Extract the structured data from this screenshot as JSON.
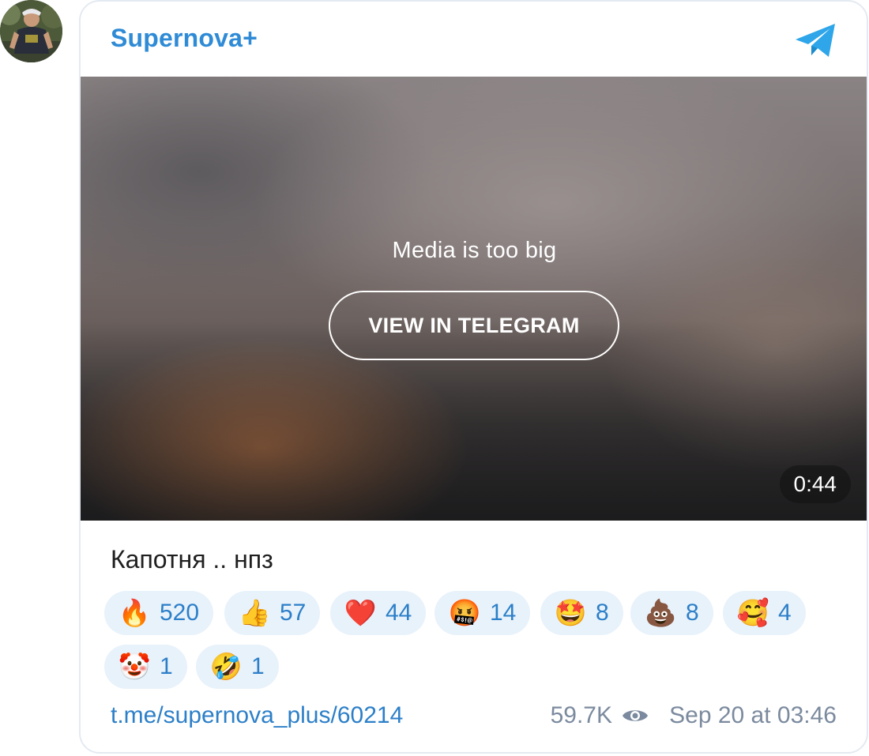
{
  "post": {
    "channel_name": "Supernova+",
    "media": {
      "message": "Media is too big",
      "button_label": "VIEW IN TELEGRAM",
      "duration": "0:44"
    },
    "caption": "Капотня .. нпз",
    "reactions": [
      {
        "emoji": "🔥",
        "icon": "fire-icon",
        "count": "520"
      },
      {
        "emoji": "👍",
        "icon": "thumbs-up-icon",
        "count": "57"
      },
      {
        "emoji": "❤️",
        "icon": "heart-icon",
        "count": "44"
      },
      {
        "emoji": "🤬",
        "icon": "cursing-face-icon",
        "count": "14"
      },
      {
        "emoji": "🤩",
        "icon": "star-struck-icon",
        "count": "8"
      },
      {
        "emoji": "💩",
        "icon": "poop-icon",
        "count": "8"
      },
      {
        "emoji": "🥰",
        "icon": "smiling-hearts-icon",
        "count": "4"
      },
      {
        "emoji": "🤡",
        "icon": "clown-icon",
        "count": "1"
      },
      {
        "emoji": "🤣",
        "icon": "rofl-icon",
        "count": "1"
      }
    ],
    "link": "t.me/supernova_plus/60214",
    "views": "59.7K",
    "date": "Sep 20 at 03:46"
  },
  "colors": {
    "accent": "#2f8bd6",
    "reaction_bg": "#e8f2fb",
    "meta_text": "#7b8a9e",
    "telegram_blue": "#2ea6e9"
  }
}
